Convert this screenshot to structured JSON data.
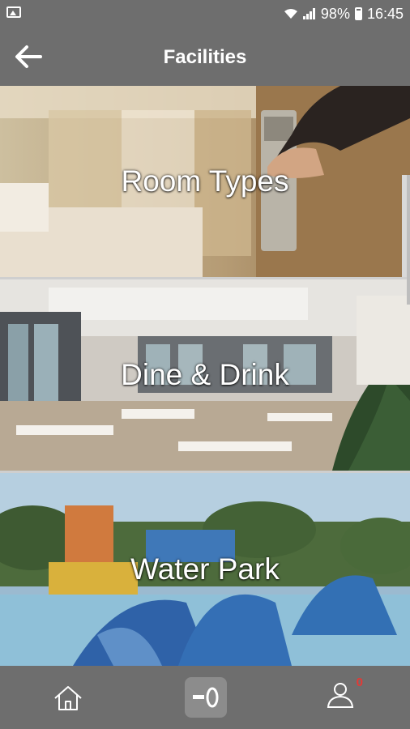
{
  "status_bar": {
    "battery": "98%",
    "time": "16:45"
  },
  "header": {
    "title": "Facilities"
  },
  "facilities": [
    {
      "label": "Room Types"
    },
    {
      "label": "Dine & Drink"
    },
    {
      "label": "Water Park"
    }
  ],
  "bottom_nav": {
    "notification_count": "0"
  },
  "colors": {
    "bar": "#6e6e6e",
    "badge": "#e53935"
  }
}
